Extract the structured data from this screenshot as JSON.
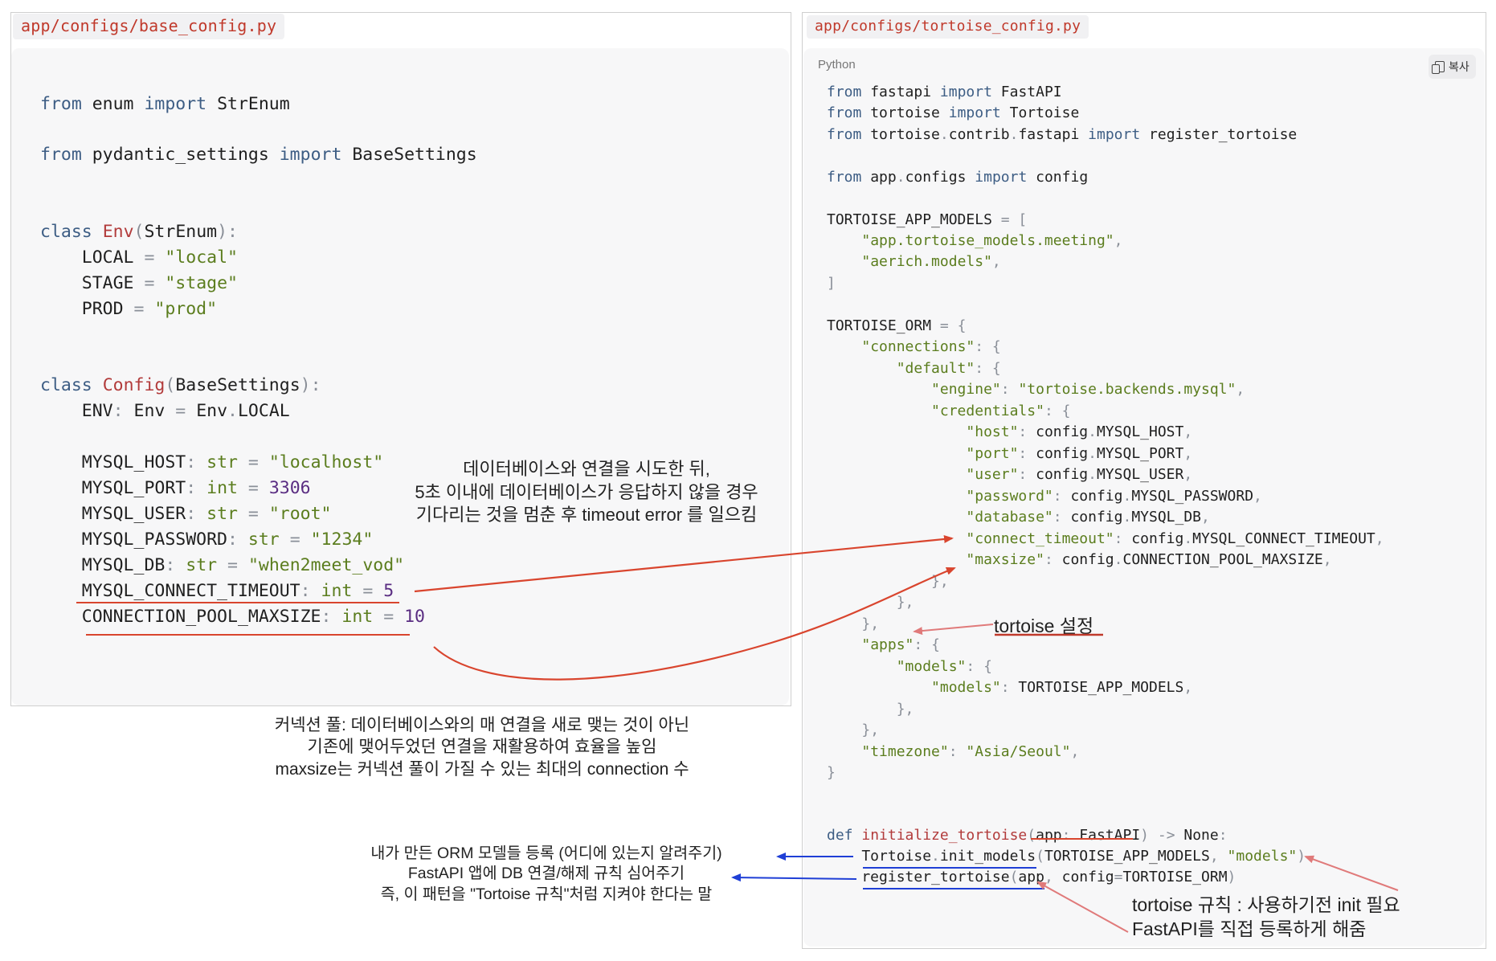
{
  "left_file": "app/configs/base_config.py",
  "right_file": "app/configs/tortoise_config.py",
  "right_language": "Python",
  "copy_label": "복사",
  "left_code": {
    "l1": [
      [
        "kw",
        "from"
      ],
      [
        "t",
        " enum "
      ],
      [
        "kw",
        "import"
      ],
      [
        "t",
        " StrEnum"
      ]
    ],
    "l2": [
      [
        "kw",
        "from"
      ],
      [
        "t",
        " pydantic_settings "
      ],
      [
        "kw",
        "import"
      ],
      [
        "t",
        " BaseSettings"
      ]
    ],
    "l3": [
      [
        "kw",
        "class"
      ],
      [
        "t",
        " "
      ],
      [
        "cls",
        "Env"
      ],
      [
        "pun",
        "("
      ],
      [
        "t",
        "StrEnum"
      ],
      [
        "pun",
        "):"
      ]
    ],
    "l4": [
      [
        "t",
        "    LOCAL "
      ],
      [
        "pun",
        "="
      ],
      [
        "t",
        " "
      ],
      [
        "str",
        "\"local\""
      ]
    ],
    "l5": [
      [
        "t",
        "    STAGE "
      ],
      [
        "pun",
        "="
      ],
      [
        "t",
        " "
      ],
      [
        "str",
        "\"stage\""
      ]
    ],
    "l6": [
      [
        "t",
        "    PROD "
      ],
      [
        "pun",
        "="
      ],
      [
        "t",
        " "
      ],
      [
        "str",
        "\"prod\""
      ]
    ],
    "l7": [
      [
        "kw",
        "class"
      ],
      [
        "t",
        " "
      ],
      [
        "cls",
        "Config"
      ],
      [
        "pun",
        "("
      ],
      [
        "t",
        "BaseSettings"
      ],
      [
        "pun",
        "):"
      ]
    ],
    "l8": [
      [
        "t",
        "    ENV"
      ],
      [
        "pun",
        ":"
      ],
      [
        "t",
        " Env "
      ],
      [
        "pun",
        "="
      ],
      [
        "t",
        " Env"
      ],
      [
        "pun",
        "."
      ],
      [
        "t",
        "LOCAL"
      ]
    ],
    "l9": [
      [
        "t",
        "    MYSQL_HOST"
      ],
      [
        "pun",
        ":"
      ],
      [
        "t",
        " "
      ],
      [
        "str",
        "str"
      ],
      [
        "t",
        " "
      ],
      [
        "pun",
        "="
      ],
      [
        "t",
        " "
      ],
      [
        "str",
        "\"localhost\""
      ]
    ],
    "l10": [
      [
        "t",
        "    MYSQL_PORT"
      ],
      [
        "pun",
        ":"
      ],
      [
        "t",
        " "
      ],
      [
        "str",
        "int"
      ],
      [
        "t",
        " "
      ],
      [
        "pun",
        "="
      ],
      [
        "t",
        " "
      ],
      [
        "num",
        "3306"
      ]
    ],
    "l11": [
      [
        "t",
        "    MYSQL_USER"
      ],
      [
        "pun",
        ":"
      ],
      [
        "t",
        " "
      ],
      [
        "str",
        "str"
      ],
      [
        "t",
        " "
      ],
      [
        "pun",
        "="
      ],
      [
        "t",
        " "
      ],
      [
        "str",
        "\"root\""
      ]
    ],
    "l12": [
      [
        "t",
        "    MYSQL_PASSWORD"
      ],
      [
        "pun",
        ":"
      ],
      [
        "t",
        " "
      ],
      [
        "str",
        "str"
      ],
      [
        "t",
        " "
      ],
      [
        "pun",
        "="
      ],
      [
        "t",
        " "
      ],
      [
        "str",
        "\"1234\""
      ]
    ],
    "l13": [
      [
        "t",
        "    MYSQL_DB"
      ],
      [
        "pun",
        ":"
      ],
      [
        "t",
        " "
      ],
      [
        "str",
        "str"
      ],
      [
        "t",
        " "
      ],
      [
        "pun",
        "="
      ],
      [
        "t",
        " "
      ],
      [
        "str",
        "\"when2meet_vod\""
      ]
    ],
    "l14": [
      [
        "t",
        "    MYSQL_CONNECT_TIMEOUT"
      ],
      [
        "pun",
        ":"
      ],
      [
        "t",
        " "
      ],
      [
        "str",
        "int"
      ],
      [
        "t",
        " "
      ],
      [
        "pun",
        "="
      ],
      [
        "t",
        " "
      ],
      [
        "num",
        "5"
      ]
    ],
    "l15": [
      [
        "t",
        "    CONNECTION_POOL_MAXSIZE"
      ],
      [
        "pun",
        ":"
      ],
      [
        "t",
        " "
      ],
      [
        "str",
        "int"
      ],
      [
        "t",
        " "
      ],
      [
        "pun",
        "="
      ],
      [
        "t",
        " "
      ],
      [
        "num",
        "10"
      ]
    ]
  },
  "right_code": {
    "r1": [
      [
        "kw",
        "from"
      ],
      [
        "t",
        " fastapi "
      ],
      [
        "kw",
        "import"
      ],
      [
        "t",
        " FastAPI"
      ]
    ],
    "r2": [
      [
        "kw",
        "from"
      ],
      [
        "t",
        " tortoise "
      ],
      [
        "kw",
        "import"
      ],
      [
        "t",
        " Tortoise"
      ]
    ],
    "r3": [
      [
        "kw",
        "from"
      ],
      [
        "t",
        " tortoise"
      ],
      [
        "pun",
        "."
      ],
      [
        "t",
        "contrib"
      ],
      [
        "pun",
        "."
      ],
      [
        "t",
        "fastapi "
      ],
      [
        "kw",
        "import"
      ],
      [
        "t",
        " register_tortoise"
      ]
    ],
    "r4": [
      [
        "kw",
        "from"
      ],
      [
        "t",
        " app"
      ],
      [
        "pun",
        "."
      ],
      [
        "t",
        "configs "
      ],
      [
        "kw",
        "import"
      ],
      [
        "t",
        " config"
      ]
    ],
    "r5": [
      [
        "t",
        "TORTOISE_APP_MODELS "
      ],
      [
        "pun",
        "= ["
      ]
    ],
    "r6": [
      [
        "t",
        "    "
      ],
      [
        "str",
        "\"app.tortoise_models.meeting\""
      ],
      [
        "pun",
        ","
      ]
    ],
    "r7": [
      [
        "t",
        "    "
      ],
      [
        "str",
        "\"aerich.models\""
      ],
      [
        "pun",
        ","
      ]
    ],
    "r8": [
      [
        "pun",
        "]"
      ]
    ],
    "r9": [
      [
        "t",
        "TORTOISE_ORM "
      ],
      [
        "pun",
        "= {"
      ]
    ],
    "r10": [
      [
        "t",
        "    "
      ],
      [
        "str",
        "\"connections\""
      ],
      [
        "pun",
        ": {"
      ]
    ],
    "r11": [
      [
        "t",
        "        "
      ],
      [
        "str",
        "\"default\""
      ],
      [
        "pun",
        ": {"
      ]
    ],
    "r12": [
      [
        "t",
        "            "
      ],
      [
        "str",
        "\"engine\""
      ],
      [
        "pun",
        ":"
      ],
      [
        "t",
        " "
      ],
      [
        "str",
        "\"tortoise.backends.mysql\""
      ],
      [
        "pun",
        ","
      ]
    ],
    "r13": [
      [
        "t",
        "            "
      ],
      [
        "str",
        "\"credentials\""
      ],
      [
        "pun",
        ": {"
      ]
    ],
    "r14": [
      [
        "t",
        "                "
      ],
      [
        "str",
        "\"host\""
      ],
      [
        "pun",
        ":"
      ],
      [
        "t",
        " config"
      ],
      [
        "pun",
        "."
      ],
      [
        "t",
        "MYSQL_HOST"
      ],
      [
        "pun",
        ","
      ]
    ],
    "r15": [
      [
        "t",
        "                "
      ],
      [
        "str",
        "\"port\""
      ],
      [
        "pun",
        ":"
      ],
      [
        "t",
        " config"
      ],
      [
        "pun",
        "."
      ],
      [
        "t",
        "MYSQL_PORT"
      ],
      [
        "pun",
        ","
      ]
    ],
    "r16": [
      [
        "t",
        "                "
      ],
      [
        "str",
        "\"user\""
      ],
      [
        "pun",
        ":"
      ],
      [
        "t",
        " config"
      ],
      [
        "pun",
        "."
      ],
      [
        "t",
        "MYSQL_USER"
      ],
      [
        "pun",
        ","
      ]
    ],
    "r17": [
      [
        "t",
        "                "
      ],
      [
        "str",
        "\"password\""
      ],
      [
        "pun",
        ":"
      ],
      [
        "t",
        " config"
      ],
      [
        "pun",
        "."
      ],
      [
        "t",
        "MYSQL_PASSWORD"
      ],
      [
        "pun",
        ","
      ]
    ],
    "r18": [
      [
        "t",
        "                "
      ],
      [
        "str",
        "\"database\""
      ],
      [
        "pun",
        ":"
      ],
      [
        "t",
        " config"
      ],
      [
        "pun",
        "."
      ],
      [
        "t",
        "MYSQL_DB"
      ],
      [
        "pun",
        ","
      ]
    ],
    "r19": [
      [
        "t",
        "                "
      ],
      [
        "str",
        "\"connect_timeout\""
      ],
      [
        "pun",
        ":"
      ],
      [
        "t",
        " config"
      ],
      [
        "pun",
        "."
      ],
      [
        "t",
        "MYSQL_CONNECT_TIMEOUT"
      ],
      [
        "pun",
        ","
      ]
    ],
    "r20": [
      [
        "t",
        "                "
      ],
      [
        "str",
        "\"maxsize\""
      ],
      [
        "pun",
        ":"
      ],
      [
        "t",
        " config"
      ],
      [
        "pun",
        "."
      ],
      [
        "t",
        "CONNECTION_POOL_MAXSIZE"
      ],
      [
        "pun",
        ","
      ]
    ],
    "r21": [
      [
        "t",
        "            "
      ],
      [
        "pun",
        "},"
      ]
    ],
    "r22": [
      [
        "t",
        "        "
      ],
      [
        "pun",
        "},"
      ]
    ],
    "r23": [
      [
        "t",
        "    "
      ],
      [
        "pun",
        "},"
      ]
    ],
    "r24": [
      [
        "t",
        "    "
      ],
      [
        "str",
        "\"apps\""
      ],
      [
        "pun",
        ": {"
      ]
    ],
    "r25": [
      [
        "t",
        "        "
      ],
      [
        "str",
        "\"models\""
      ],
      [
        "pun",
        ": {"
      ]
    ],
    "r26": [
      [
        "t",
        "            "
      ],
      [
        "str",
        "\"models\""
      ],
      [
        "pun",
        ":"
      ],
      [
        "t",
        " TORTOISE_APP_MODELS"
      ],
      [
        "pun",
        ","
      ]
    ],
    "r27": [
      [
        "t",
        "        "
      ],
      [
        "pun",
        "},"
      ]
    ],
    "r28": [
      [
        "t",
        "    "
      ],
      [
        "pun",
        "},"
      ]
    ],
    "r29": [
      [
        "t",
        "    "
      ],
      [
        "str",
        "\"timezone\""
      ],
      [
        "pun",
        ":"
      ],
      [
        "t",
        " "
      ],
      [
        "str",
        "\"Asia/Seoul\""
      ],
      [
        "pun",
        ","
      ]
    ],
    "r30": [
      [
        "pun",
        "}"
      ]
    ],
    "r31": [
      [
        "kw",
        "def"
      ],
      [
        "t",
        " "
      ],
      [
        "cls",
        "initialize_tortoise"
      ],
      [
        "pun",
        "("
      ],
      [
        "t",
        "app"
      ],
      [
        "pun",
        ":"
      ],
      [
        "t",
        " FastAPI"
      ],
      [
        "pun",
        ")"
      ],
      [
        "t",
        " "
      ],
      [
        "pun",
        "->"
      ],
      [
        "t",
        " None"
      ],
      [
        "pun",
        ":"
      ]
    ],
    "r32": [
      [
        "t",
        "    Tortoise"
      ],
      [
        "pun",
        "."
      ],
      [
        "t",
        "init_models"
      ],
      [
        "pun",
        "("
      ],
      [
        "t",
        "TORTOISE_APP_MODELS"
      ],
      [
        "pun",
        ","
      ],
      [
        "t",
        " "
      ],
      [
        "str",
        "\"models\""
      ],
      [
        "pun",
        ")"
      ]
    ],
    "r33": [
      [
        "t",
        "    register_tortoise"
      ],
      [
        "pun",
        "("
      ],
      [
        "t",
        "app"
      ],
      [
        "pun",
        ","
      ],
      [
        "t",
        " config"
      ],
      [
        "pun",
        "="
      ],
      [
        "t",
        "TORTOISE_ORM"
      ],
      [
        "pun",
        ")"
      ]
    ]
  },
  "notes": {
    "timeout": [
      "데이터베이스와 연결을 시도한 뒤,",
      "5초 이내에 데이터베이스가 응답하지 않을 경우",
      "기다리는 것을 멈춘 후 timeout error 를 일으킴"
    ],
    "pool": [
      "커넥션 풀: 데이터베이스와의 매 연결을 새로 맺는 것이 아닌",
      "기존에 맺어두었던 연결을 재활용하여 효율을 높임",
      "maxsize는 커넥션 풀이 가질 수 있는 최대의 connection 수"
    ],
    "tortoise_setting": "tortoise 설정",
    "register": [
      "내가 만든 ORM 모델들 등록 (어디에 있는지 알려주기)",
      "FastAPI 앱에 DB 연결/해제 규칙 심어주기",
      "즉, 이 패턴을 \"Tortoise 규칙\"처럼 지켜야 한다는 말"
    ],
    "rule": [
      "tortoise 규칙 : 사용하기전 init 필요",
      "FastAPI를 직접 등록하게 해줌"
    ]
  },
  "colors": {
    "annotation_red": "#d9452e",
    "annotation_blue": "#1f3fd6",
    "keyword": "#3d5d84",
    "string": "#5b7d1e"
  }
}
